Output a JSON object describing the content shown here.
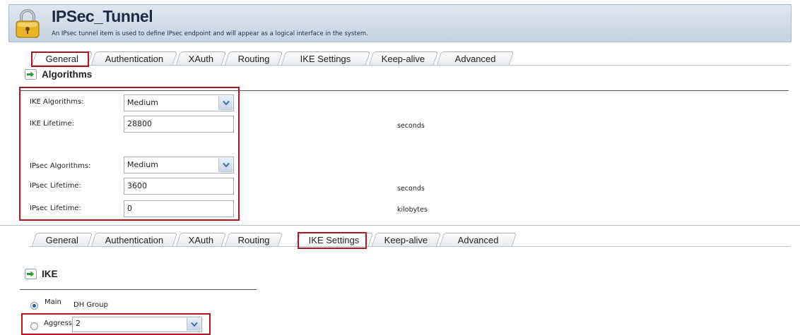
{
  "header": {
    "title": "IPSec_Tunnel",
    "subtitle": "An IPsec tunnel item is used to define IPsec endpoint and will appear as a logical interface in the system."
  },
  "tabs": [
    {
      "label": "General"
    },
    {
      "label": "Authentication"
    },
    {
      "label": "XAuth"
    },
    {
      "label": "Routing"
    },
    {
      "label": "IKE Settings"
    },
    {
      "label": "Keep-alive"
    },
    {
      "label": "Advanced"
    }
  ],
  "top_panel": {
    "active_tab": "General",
    "section_title": "Algorithms",
    "fields": {
      "ike_algorithms": {
        "label": "IKE Algorithms:",
        "value": "Medium"
      },
      "ike_lifetime": {
        "label": "IKE Lifetime:",
        "value": "28800",
        "unit": "seconds"
      },
      "ipsec_algorithms": {
        "label": "IPsec Algorithms:",
        "value": "Medium"
      },
      "ipsec_lifetime_seconds": {
        "label": "IPsec Lifetime:",
        "value": "3600",
        "unit": "seconds"
      },
      "ipsec_lifetime_kb": {
        "label": "IPsec Lifetime:",
        "value": "0",
        "unit": "kilobytes"
      }
    }
  },
  "bottom_panel": {
    "active_tab": "IKE Settings",
    "section_title": "IKE",
    "mode_main": "Main",
    "mode_aggressive": "Aggressive",
    "selected_mode": "Main",
    "dh_group_label": "DH Group",
    "dh_group_value": "2"
  },
  "colors": {
    "highlight": "#b0161b",
    "header_bg": "#cfd9e6"
  }
}
